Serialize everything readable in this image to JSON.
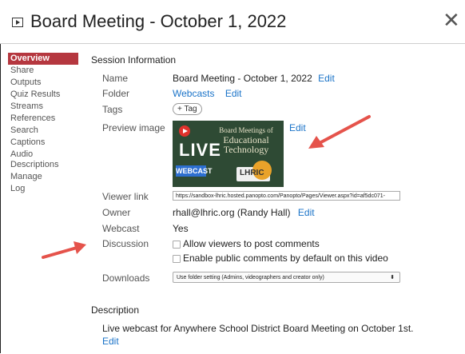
{
  "header": {
    "title": "Board Meeting - October 1, 2022"
  },
  "sidebar": {
    "items": [
      {
        "label": "Overview"
      },
      {
        "label": "Share"
      },
      {
        "label": "Outputs"
      },
      {
        "label": "Quiz Results"
      },
      {
        "label": "Streams"
      },
      {
        "label": "References"
      },
      {
        "label": "Search"
      },
      {
        "label": "Captions"
      },
      {
        "label": "Audio Descriptions"
      },
      {
        "label": "Manage"
      },
      {
        "label": "Log"
      }
    ]
  },
  "session": {
    "heading": "Session Information",
    "name_label": "Name",
    "name_value": "Board Meeting - October 1, 2022",
    "edit": "Edit",
    "folder_label": "Folder",
    "folder_value": "Webcasts",
    "tags_label": "Tags",
    "tag_button": "+ Tag",
    "preview_label": "Preview image",
    "thumb_line1": "Board Meetings of",
    "thumb_line2": "Educational",
    "thumb_line3": "Technology",
    "thumb_live": "LIVE",
    "thumb_webcast": "WEBCAST",
    "thumb_logo": "LHRIC",
    "viewer_label": "Viewer link",
    "viewer_url": "https://sandbox-lhric.hosted.panopto.com/Panopto/Pages/Viewer.aspx?id=af5dc071-",
    "owner_label": "Owner",
    "owner_value": "rhall@lhric.org (Randy Hall)",
    "webcast_label": "Webcast",
    "webcast_value": "Yes",
    "discussion_label": "Discussion",
    "discussion_opt1": "Allow viewers to post comments",
    "discussion_opt2": "Enable public comments by default on this video",
    "downloads_label": "Downloads",
    "downloads_value": "Use folder setting (Admins, videographers and creator only)"
  },
  "description": {
    "heading": "Description",
    "text": "Live webcast for Anywhere School District Board Meeting on October 1st.",
    "edit": "Edit"
  },
  "colors": {
    "accent": "#b5373f",
    "link": "#1a73c8",
    "annotation": "#e5534b"
  }
}
